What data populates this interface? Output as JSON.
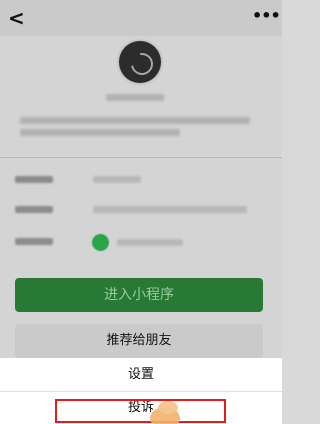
{
  "header": {
    "back_glyph": "<",
    "more_glyph": "•••"
  },
  "buttons": {
    "enter": "进入小程序",
    "recommend": "推荐给朋友"
  },
  "sheet": {
    "settings": "设置",
    "complaint": "投诉"
  },
  "colors": {
    "highlight": "#e41b1b",
    "primary": "#287c36"
  }
}
